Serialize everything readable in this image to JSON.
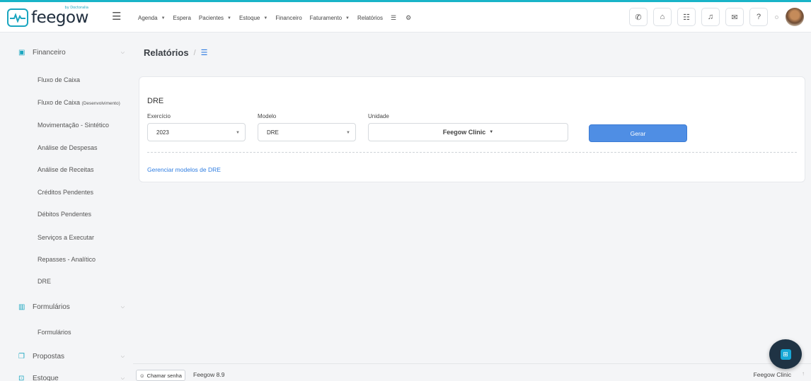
{
  "brand": {
    "name": "feegow",
    "sub": "by Doctoralia"
  },
  "nav": [
    {
      "label": "Agenda",
      "dropdown": true
    },
    {
      "label": "Espera",
      "dropdown": false
    },
    {
      "label": "Pacientes",
      "dropdown": true
    },
    {
      "label": "Estoque",
      "dropdown": true
    },
    {
      "label": "Financeiro",
      "dropdown": false
    },
    {
      "label": "Faturamento",
      "dropdown": true
    },
    {
      "label": "Relatórios",
      "dropdown": false
    }
  ],
  "sidebar": {
    "financeiro": "Financeiro",
    "items": [
      "Fluxo de Caixa",
      "Fluxo de Caixa",
      "Movimentação - Sintético",
      "Análise de Despesas",
      "Análise de Receitas",
      "Créditos Pendentes",
      "Débitos Pendentes",
      "Serviços a Executar",
      "Repasses - Analítico",
      "DRE"
    ],
    "item1_suffix": "(Desenvolvimento)",
    "formularios_group": "Formulários",
    "formularios_item": "Formulários",
    "propostas": "Propostas",
    "estoque": "Estoque"
  },
  "breadcrumb": {
    "title": "Relatórios",
    "sep": "/"
  },
  "form": {
    "title": "DRE",
    "exercicio_label": "Exercício",
    "exercicio_value": "2023",
    "modelo_label": "Modelo",
    "modelo_value": "DRE",
    "unidade_label": "Unidade",
    "unidade_value": "Feegow Clinic",
    "submit": "Gerar",
    "manage_link": "Gerenciar modelos de DRE"
  },
  "footer": {
    "chamar_senha": "Chamar senha",
    "version": "Feegow 8.9",
    "clinic": "Feegow Clinic"
  },
  "colors": {
    "accent": "#4f8ee4",
    "brand": "#1aa6c0",
    "link": "#2f7de1"
  }
}
